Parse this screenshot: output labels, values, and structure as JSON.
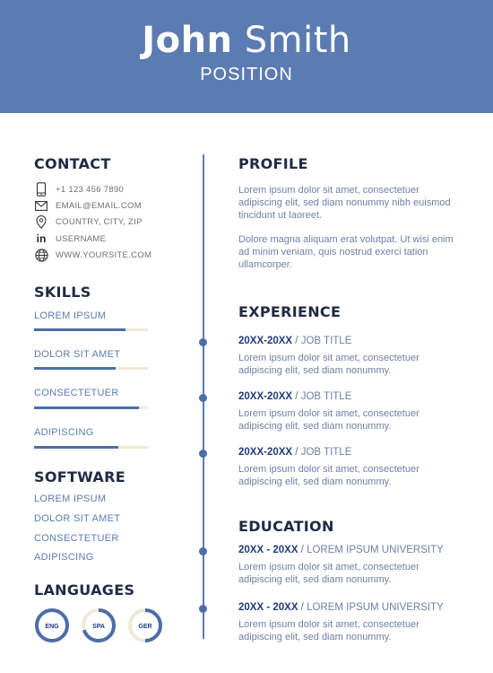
{
  "header": {
    "first_name": "John",
    "last_name": "Smith",
    "position": "POSITION"
  },
  "contact": {
    "heading": "CONTACT",
    "items": [
      {
        "icon": "phone-icon",
        "text": "+1 123 456 7890"
      },
      {
        "icon": "email-icon",
        "text": "EMAIL@EMAIL.COM"
      },
      {
        "icon": "location-icon",
        "text": "COUNTRY, CITY, ZIP"
      },
      {
        "icon": "linkedin-icon",
        "text": "USERNAME"
      },
      {
        "icon": "globe-icon",
        "text": "WWW.YOURSITE.COM"
      }
    ]
  },
  "skills": {
    "heading": "SKILLS",
    "items": [
      {
        "label": "LOREM IPSUM",
        "level": 0.8
      },
      {
        "label": "DOLOR SIT AMET",
        "level": 0.72
      },
      {
        "label": "CONSECTETUER",
        "level": 0.92
      },
      {
        "label": "ADIPISCING",
        "level": 0.74
      }
    ]
  },
  "software": {
    "heading": "SOFTWARE",
    "items": [
      "LOREM IPSUM",
      "DOLOR SIT AMET",
      "CONSECTETUER",
      "ADIPISCING"
    ]
  },
  "languages": {
    "heading": "LANGUAGES",
    "items": [
      {
        "code": "ENG",
        "level": 1.0
      },
      {
        "code": "SPA",
        "level": 0.7
      },
      {
        "code": "GER",
        "level": 0.5
      }
    ]
  },
  "profile": {
    "heading": "PROFILE",
    "paragraphs": [
      "Lorem ipsum dolor sit amet, consectetuer adipiscing elit, sed diam nonummy nibh euismod tincidunt ut laoreet.",
      "Dolore magna aliquam erat volutpat. Ut wisi enim ad minim veniam, quis nostrud exerci tation ullamcorper."
    ]
  },
  "experience": {
    "heading": "EXPERIENCE",
    "entries": [
      {
        "years": "20XX-20XX",
        "separator": " / ",
        "title": "JOB TITLE",
        "desc": "Lorem ipsum dolor sit amet, consectetuer adipiscing elit, sed diam nonummy."
      },
      {
        "years": "20XX-20XX",
        "separator": " / ",
        "title": "JOB TITLE",
        "desc": "Lorem ipsum dolor sit amet, consectetuer adipiscing elit, sed diam nonummy."
      },
      {
        "years": "20XX-20XX",
        "separator": " / ",
        "title": "JOB TITLE",
        "desc": "Lorem ipsum dolor sit amet, consectetuer adipiscing elit, sed diam nonummy."
      }
    ]
  },
  "education": {
    "heading": "EDUCATION",
    "entries": [
      {
        "years": "20XX - 20XX",
        "separator": " / ",
        "title": "LOREM IPSUM UNIVERSITY",
        "desc": "Lorem ipsum dolor sit amet, consectetuer adipiscing elit, sed diam nonummy."
      },
      {
        "years": "20XX - 20XX",
        "separator": " / ",
        "title": "LOREM IPSUM UNIVERSITY",
        "desc": "Lorem ipsum dolor sit amet, consectetuer adipiscing elit, sed diam nonummy."
      }
    ]
  },
  "colors": {
    "accent": "#5b7cb2",
    "bar_fill": "#4c6ea8",
    "bar_track": "#efe9d8",
    "heading": "#1f2a44"
  }
}
